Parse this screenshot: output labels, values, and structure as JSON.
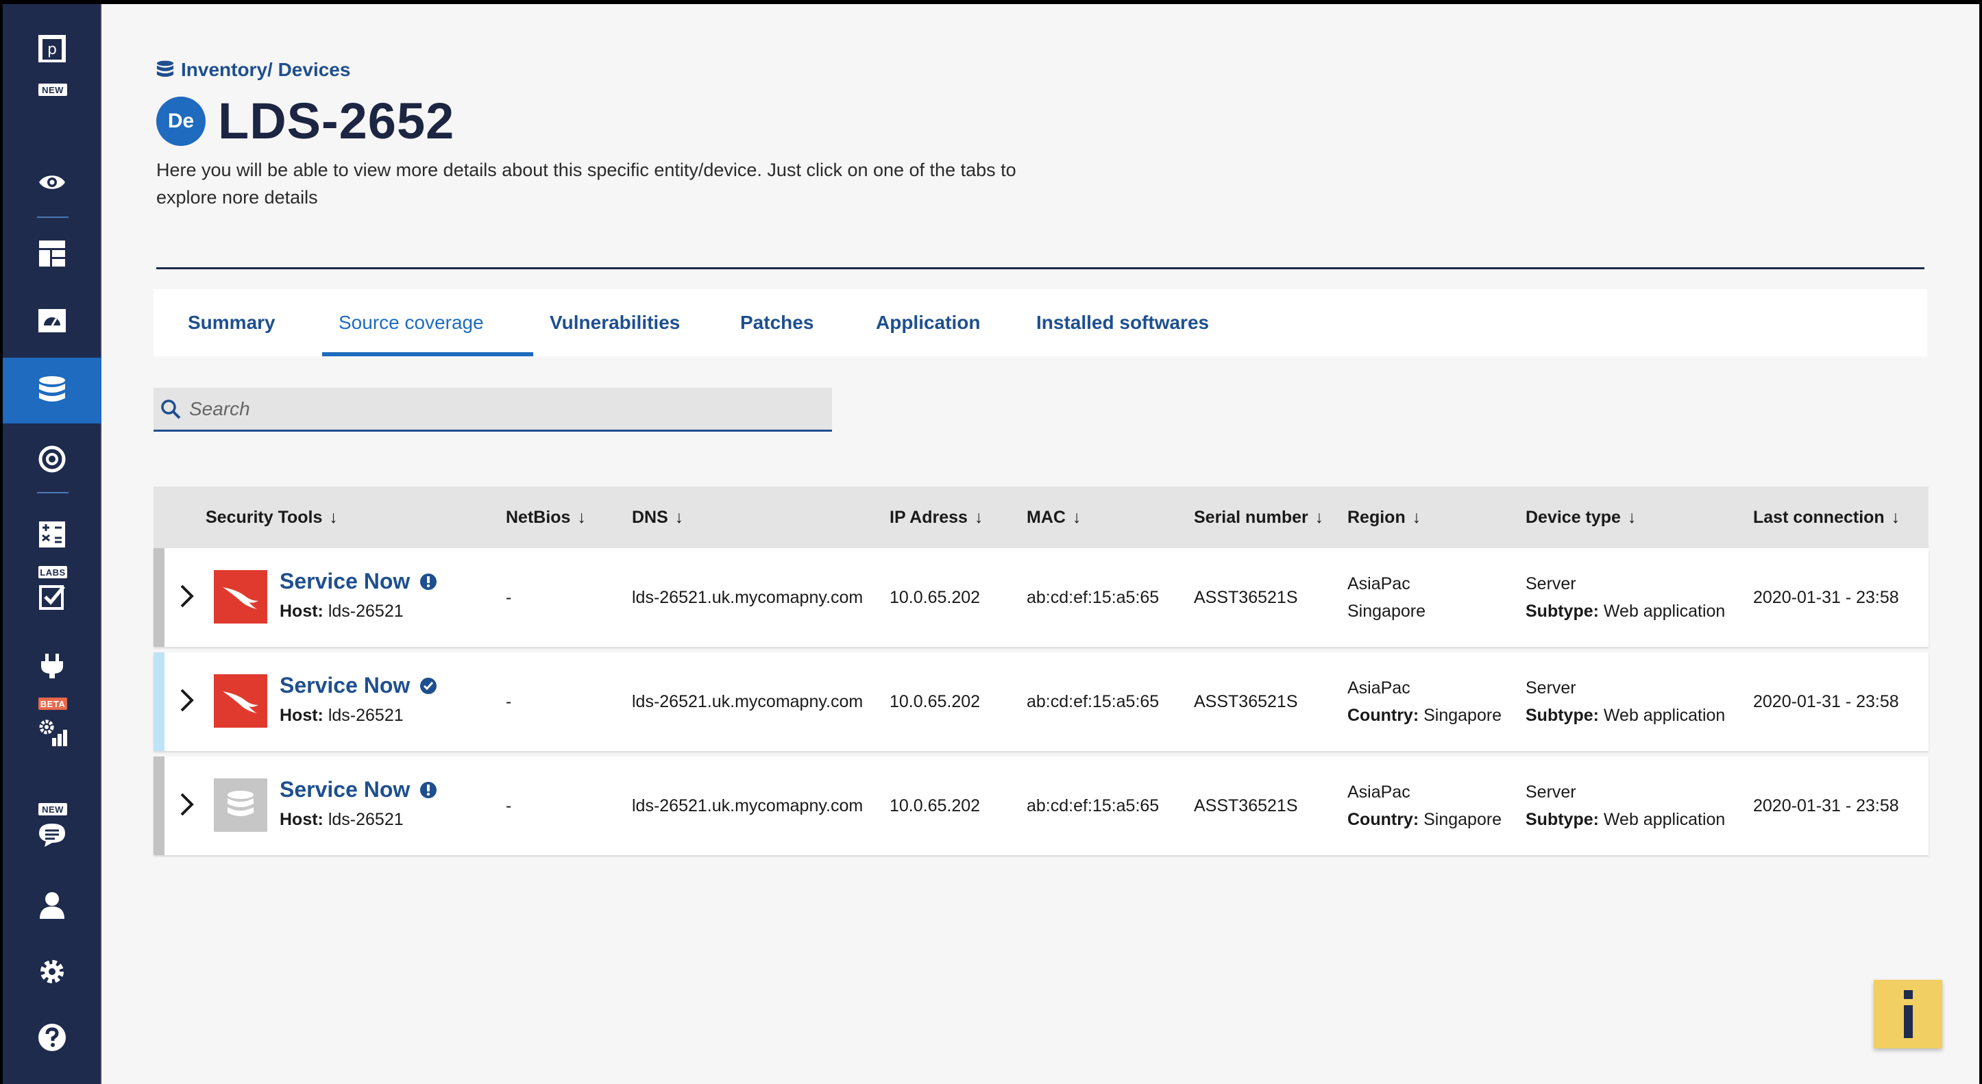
{
  "sidebar": {
    "logo_letter": "p",
    "tags": {
      "new_top": "NEW",
      "labs": "LABS",
      "beta": "BETA",
      "new_chat": "NEW"
    },
    "items": [
      {
        "name": "sidebar-item-logo",
        "icon": "logo-icon"
      },
      {
        "name": "sidebar-item-overview",
        "icon": "eye-icon"
      },
      {
        "name": "sidebar-item-dashboard",
        "icon": "dashboard-icon"
      },
      {
        "name": "sidebar-item-monitor",
        "icon": "gauge-icon"
      },
      {
        "name": "sidebar-item-inventory",
        "icon": "database-icon",
        "active": true
      },
      {
        "name": "sidebar-item-targets",
        "icon": "target-icon"
      },
      {
        "name": "sidebar-item-calculator",
        "icon": "calculator-icon"
      },
      {
        "name": "sidebar-item-labs",
        "icon": "checklist-icon"
      },
      {
        "name": "sidebar-item-integrations",
        "icon": "plug-icon"
      },
      {
        "name": "sidebar-item-analytics",
        "icon": "settings-chart-icon"
      },
      {
        "name": "sidebar-item-chat",
        "icon": "chat-icon"
      },
      {
        "name": "sidebar-item-profile",
        "icon": "user-icon"
      },
      {
        "name": "sidebar-item-settings",
        "icon": "gear-icon"
      },
      {
        "name": "sidebar-item-help",
        "icon": "help-icon"
      }
    ]
  },
  "header": {
    "breadcrumb": "Inventory/ Devices",
    "avatar_initials": "De",
    "title": "LDS-2652",
    "description": "Here you will be able to view more details about this specific entity/device. Just click on one of the tabs to explore nore details"
  },
  "tabs": [
    {
      "label": "Summary",
      "active": false
    },
    {
      "label": "Source coverage",
      "active": true
    },
    {
      "label": "Vulnerabilities",
      "active": false
    },
    {
      "label": "Patches",
      "active": false
    },
    {
      "label": "Application",
      "active": false
    },
    {
      "label": "Installed softwares",
      "active": false
    }
  ],
  "search": {
    "placeholder": "Search"
  },
  "table": {
    "columns": [
      "Security Tools",
      "NetBios",
      "DNS",
      "IP Adress",
      "MAC",
      "Serial number",
      "Region",
      "Device type",
      "Last connection"
    ],
    "host_label": "Host:",
    "subtype_label": "Subtype:",
    "country_label": "Country:",
    "rows": [
      {
        "tool": "Service Now",
        "status_icon": "alert-icon",
        "logo": "red",
        "bar_color": "#c3c3c3",
        "host": "lds-26521",
        "netbios": "-",
        "dns": "lds-26521.uk.mycomapny.com",
        "ip": "10.0.65.202",
        "mac": "ab:cd:ef:15:a5:65",
        "serial": "ASST36521S",
        "region": "AsiaPac",
        "region_sub": "Singapore",
        "region_sub_labeled": false,
        "device_type": "Server",
        "subtype": "Web application",
        "last_connection": "2020-01-31 - 23:58"
      },
      {
        "tool": "Service Now",
        "status_icon": "check-icon",
        "logo": "red",
        "bar_color": "#bfe3f6",
        "host": "lds-26521",
        "netbios": "-",
        "dns": "lds-26521.uk.mycomapny.com",
        "ip": "10.0.65.202",
        "mac": "ab:cd:ef:15:a5:65",
        "serial": "ASST36521S",
        "region": "AsiaPac",
        "region_sub": "Singapore",
        "region_sub_labeled": true,
        "device_type": "Server",
        "subtype": "Web application",
        "last_connection": "2020-01-31 - 23:58"
      },
      {
        "tool": "Service Now",
        "status_icon": "alert-icon",
        "logo": "gray",
        "bar_color": "#c3c3c3",
        "host": "lds-26521",
        "netbios": "-",
        "dns": "lds-26521.uk.mycomapny.com",
        "ip": "10.0.65.202",
        "mac": "ab:cd:ef:15:a5:65",
        "serial": "ASST36521S",
        "region": "AsiaPac",
        "region_sub": "Singapore",
        "region_sub_labeled": true,
        "device_type": "Server",
        "subtype": "Web application",
        "last_connection": "2020-01-31 - 23:58"
      }
    ]
  },
  "info_button": {
    "label": "i"
  },
  "colors": {
    "sidebar": "#1f2b4d",
    "accent": "#1e6bbf",
    "brand_red": "#e03a2f",
    "info_yellow": "#f2cf63"
  }
}
